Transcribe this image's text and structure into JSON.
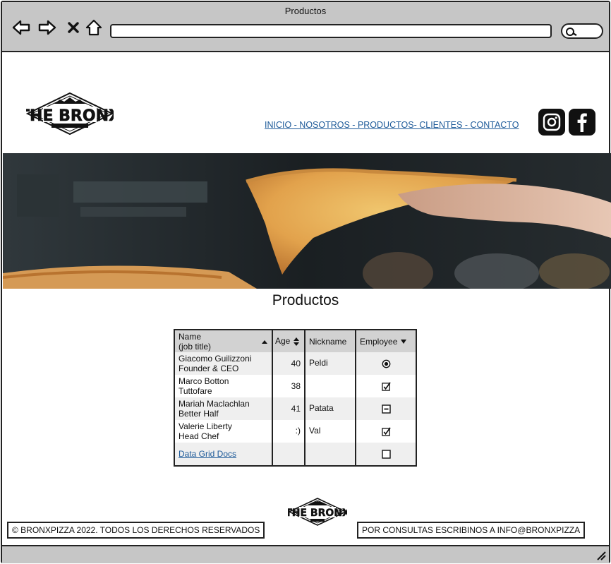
{
  "window": {
    "title": "Productos"
  },
  "header": {
    "logo_text": "THE BRONX",
    "menu_text": "INICIO - NOSOTROS - PRODUCTOS- CLIENTES - CONTACTO",
    "social": [
      "instagram-icon",
      "facebook-icon"
    ]
  },
  "main": {
    "title": "Productos",
    "grid": {
      "columns": [
        "Name",
        "(job title)",
        "Age",
        "Nickname",
        "Employee"
      ],
      "rows": [
        {
          "name": "Giacomo Guilizzoni",
          "job": "Founder & CEO",
          "age": "40",
          "nickname": "Peldi",
          "employee": "radio-selected"
        },
        {
          "name": "Marco Botton",
          "job": "Tuttofare",
          "age": "38",
          "nickname": "",
          "employee": "checkbox-checked"
        },
        {
          "name": "Mariah Maclachlan",
          "job": "Better Half",
          "age": "41",
          "nickname": "Patata",
          "employee": "checkbox-indeterminate"
        },
        {
          "name": "Valerie Liberty",
          "job": "Head Chef",
          "age": ":)",
          "nickname": "Val",
          "employee": "checkbox-checked"
        }
      ],
      "link_row": {
        "label": "Data Grid Docs",
        "employee": "checkbox-unchecked"
      }
    }
  },
  "footer": {
    "copyright": "© BRONXPIZZA 2022. TODOS LOS DERECHOS RESERVADOS",
    "contact": "POR CONSULTAS ESCRIBINOS A INFO@BRONXPIZZA"
  },
  "colors": {
    "chrome": "#c6c6c6",
    "link": "#1d5a99",
    "grid_header": "#d2d2d2"
  }
}
